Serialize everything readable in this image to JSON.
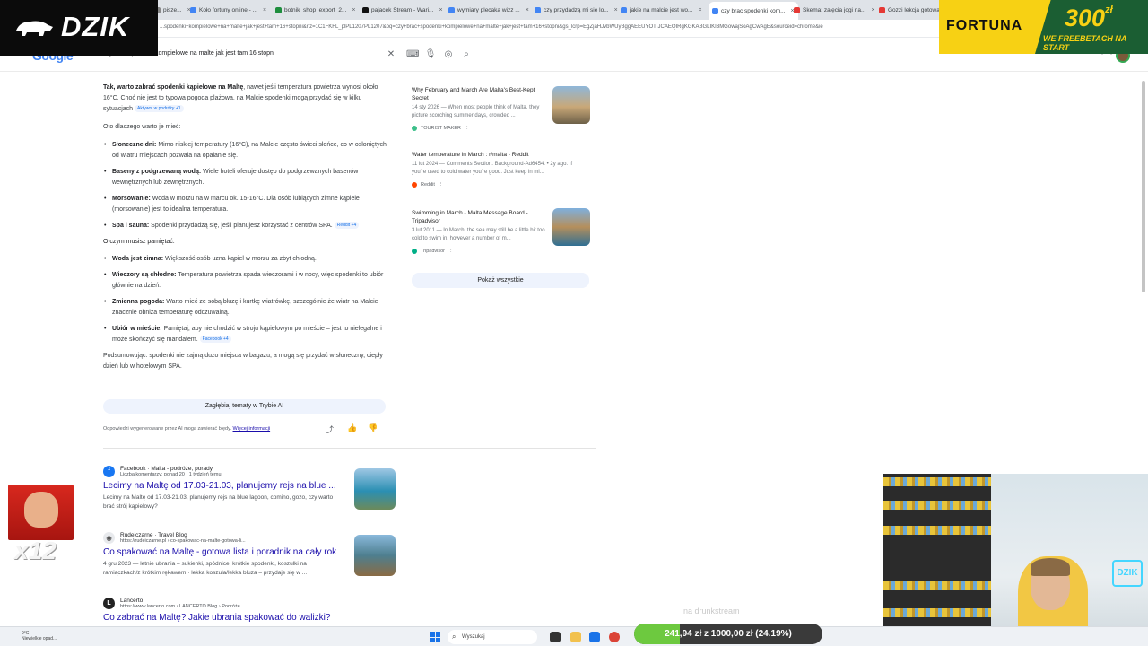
{
  "browser": {
    "tabs": [
      {
        "label": "pisze..."
      },
      {
        "label": "Koło fortuny online - ..."
      },
      {
        "label": "botnik_shop_export_2..."
      },
      {
        "label": "pajacek Stream - Wari..."
      },
      {
        "label": "wymiary plecaka wizz ..."
      },
      {
        "label": "czy przydadzą mi się lo..."
      },
      {
        "label": "jakie na malcie jest wo..."
      },
      {
        "label": "czy brac spodenki kom..."
      },
      {
        "label": "Skema: zajęcia jogi na..."
      },
      {
        "label": "Gozzi lekcja gotowan..."
      }
    ],
    "url": "...spodenki+kompielowe+na+malte+jak+jest+tam+16+stopni&rlz=1C1FKFL_plPL1207PL1207&oq=czy+brac+spodenki+kompielowe+na+malte+jak+jest+tam+16+stopni&gs_lcrp=EgZjaHJvbWUyBggAEEUYOTIJCAEQIRgKGKABGLIKI3MGowajSoAgCwAgE&sourceid=chrome&ie"
  },
  "search": {
    "logo": "Google",
    "query": "czy brać spodenki kompielowe na malte jak jest tam 16 stopni"
  },
  "overlay": {
    "brand": "DZIK",
    "ad_brand": "FORTUNA",
    "ad_amount": "300",
    "ad_currency": "zł",
    "ad_sub": "WE FREEBETACH NA START",
    "meme_count": "x12",
    "watermark": "na drunkstream"
  },
  "ai_overview": {
    "intro_bold": "Tak, warto zabrać spodenki kąpielowe na Maltę",
    "intro_rest": ", nawet jeśli temperatura powietrza wynosi około 16°C. Choć nie jest to typowa pogoda plażowa, na Malcie spodenki mogą przydać się w kilku sytuacjach",
    "intro_chip": "Aktywni w podróży +1",
    "why": "Oto dlaczego warto je mieć:",
    "bullets1": [
      {
        "b": "Słoneczne dni:",
        "t": " Mimo niskiej temperatury (16°C), na Malcie często świeci słońce, co w osłoniętych od wiatru miejscach pozwala na opalanie się.",
        "chip": ""
      },
      {
        "b": "Baseny z podgrzewaną wodą:",
        "t": " Wiele hoteli oferuje dostęp do podgrzewanych basenów wewnętrznych lub zewnętrznych.",
        "chip": ""
      },
      {
        "b": "Morsowanie:",
        "t": " Woda w morzu na w marcu ok. 15-16°C. Dla osób lubiących zimne kąpiele (morsowanie) jest to idealna temperatura.",
        "chip": ""
      },
      {
        "b": "Spa i sauna:",
        "t": " Spodenki przydadzą się, jeśli planujesz korzystać z centrów SPA.",
        "chip": "Reddit +4"
      }
    ],
    "remember": "O czym musisz pamiętać:",
    "bullets2": [
      {
        "b": "Woda jest zimna:",
        "t": " Większość osób uzna kąpiel w morzu za zbyt chłodną.",
        "chip": ""
      },
      {
        "b": "Wieczory są chłodne:",
        "t": " Temperatura powietrza spada wieczorami i w nocy, więc spodenki to ubiór głównie na dzień.",
        "chip": ""
      },
      {
        "b": "Zmienna pogoda:",
        "t": " Warto mieć ze sobą bluzę i kurtkę wiatrówkę, szczególnie że wiatr na Malcie znacznie obniża temperaturę odczuwalną.",
        "chip": ""
      },
      {
        "b": "Ubiór w mieście:",
        "t": " Pamiętaj, aby nie chodzić w stroju kąpielowym po mieście – jest to nielegalne i może skończyć się mandatem.",
        "chip": "Facebook +4"
      }
    ],
    "summary": "Podsumowując: spodenki nie zajmą dużo miejsca w bagażu, a mogą się przydać w słoneczny, ciepły dzień lub w hotelowym SPA.",
    "deep_button": "Zagłębiaj tematy w Trybie AI",
    "disclaimer": "Odpowiedzi wygenerowane przez AI mogą zawierać błędy.",
    "disclaimer_link": "Więcej informacji"
  },
  "sources": [
    {
      "title": "Why February and March Are Malta's Best-Kept Secret",
      "snippet": "14 sty 2026 — When most people think of Malta, they picture scorching summer days, crowded ...",
      "site": "TOURIST MAKER"
    },
    {
      "title": "Water temperature in March : r/malta - Reddit",
      "snippet": "11 lut 2024 — Comments Section. Background-Ad6454. • 2y ago. If you're used to cold water you're good. Just keep in mi...",
      "site": "Reddit"
    },
    {
      "title": "Swimming in March - Malta Message Board - Tripadvisor",
      "snippet": "3 lut 2011 — In March, the sea may still be a little bit too cold to swim in, however a number of m...",
      "site": "Tripadvisor"
    }
  ],
  "show_all": "Pokaż wszystkie",
  "results": [
    {
      "site": "Facebook · Malta - podróże, porady",
      "crumb": "Liczba komentarzy: ponad 20 · 1 tydzień temu",
      "title": "Lecimy na Maltę od 17.03-21.03, planujemy rejs na blue ...",
      "snippet": "Lecimy na Maltę od 17.03-21.03, planujemy rejs na blue lagoon, comino, gozo, czy warto brać strój kąpielowy?"
    },
    {
      "site": "Rudeiczarne · Travel Blog",
      "crumb": "https://rudeiczarne.pl › co-spakowac-na-malte-gotowa-li...",
      "title": "Co spakować na Maltę - gotowa lista i poradnik na cały rok",
      "snippet": "4 gru 2023 — letnie ubrania – sukienki, spódnice, krótkie spodenki, koszulki na ramiączkach/z krótkim rękawem · lekka koszula/lekka bluza – przydaje się w ..."
    },
    {
      "site": "Lancerto",
      "crumb": "https://www.lancerto.com › LANCERTO Blog › Podróże",
      "title": "Co zabrać na Maltę? Jakie ubrania spakować do walizki?",
      "snippet": ""
    }
  ],
  "taskbar": {
    "weather_temp": "9°C",
    "weather_desc": "Niewielkie opad...",
    "search_placeholder": "Wyszukaj",
    "goal_text": "241,94 zł z 1000,00 zł (24.19%)",
    "goal_fraction": 0.2419
  }
}
